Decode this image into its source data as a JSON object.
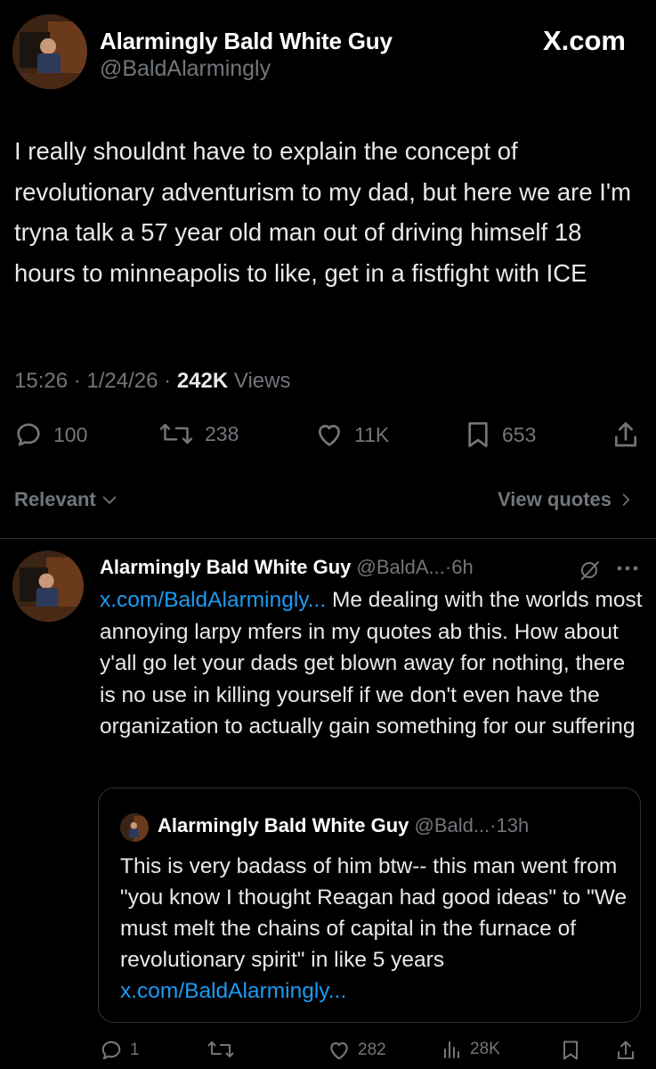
{
  "brand": {
    "label": "X.com"
  },
  "author": {
    "name": "Alarmingly Bald White Guy",
    "handle": "@BaldAlarmingly"
  },
  "tweet": {
    "text": "I really shouldnt have to explain the concept of revolutionary adventurism to my dad, but here we are I'm tryna talk a 57 year old man out of driving himself 18 hours to minneapolis to like, get in a fistfight with ICE",
    "time": "15:26",
    "date": "1/24/26",
    "views_count": "242K",
    "views_label": "Views",
    "sep": "·"
  },
  "actions": {
    "replies": "100",
    "reposts": "238",
    "likes": "11K",
    "bookmarks": "653"
  },
  "filters": {
    "relevant": "Relevant",
    "view_quotes": "View quotes"
  },
  "reply": {
    "name": "Alarmingly Bald White Guy",
    "handle": "@BaldA...",
    "time": "6h",
    "link": "x.com/BaldAlarmingly...",
    "text": " Me dealing with  the worlds most annoying larpy mfers in my quotes ab this. How about y'all go let your dads get blown away for nothing, there is no use in killing yourself if we don't even have the organization to actually gain something for our suffering",
    "quote": {
      "name": "Alarmingly Bald White Guy",
      "handle": "@Bald...",
      "time": "13h",
      "text": "This is very badass of him btw-- this man went from \"you know I thought Reagan had good ideas\" to \"We must melt the chains of capital in the furnace of revolutionary spirit\" in like 5 years ",
      "link": "x.com/BaldAlarmingly..."
    },
    "actions": {
      "replies": "1",
      "likes": "282",
      "views": "28K"
    }
  },
  "colors": {
    "background": "#000000",
    "text": "#e7e9ea",
    "muted": "#71767b",
    "link": "#1d9bf0",
    "divider": "#2f3336"
  },
  "icons": [
    "reply-icon",
    "repost-icon",
    "like-icon",
    "bookmark-icon",
    "share-icon",
    "chevron-down-icon",
    "chevron-right-icon",
    "grok-icon",
    "more-icon",
    "views-icon"
  ]
}
